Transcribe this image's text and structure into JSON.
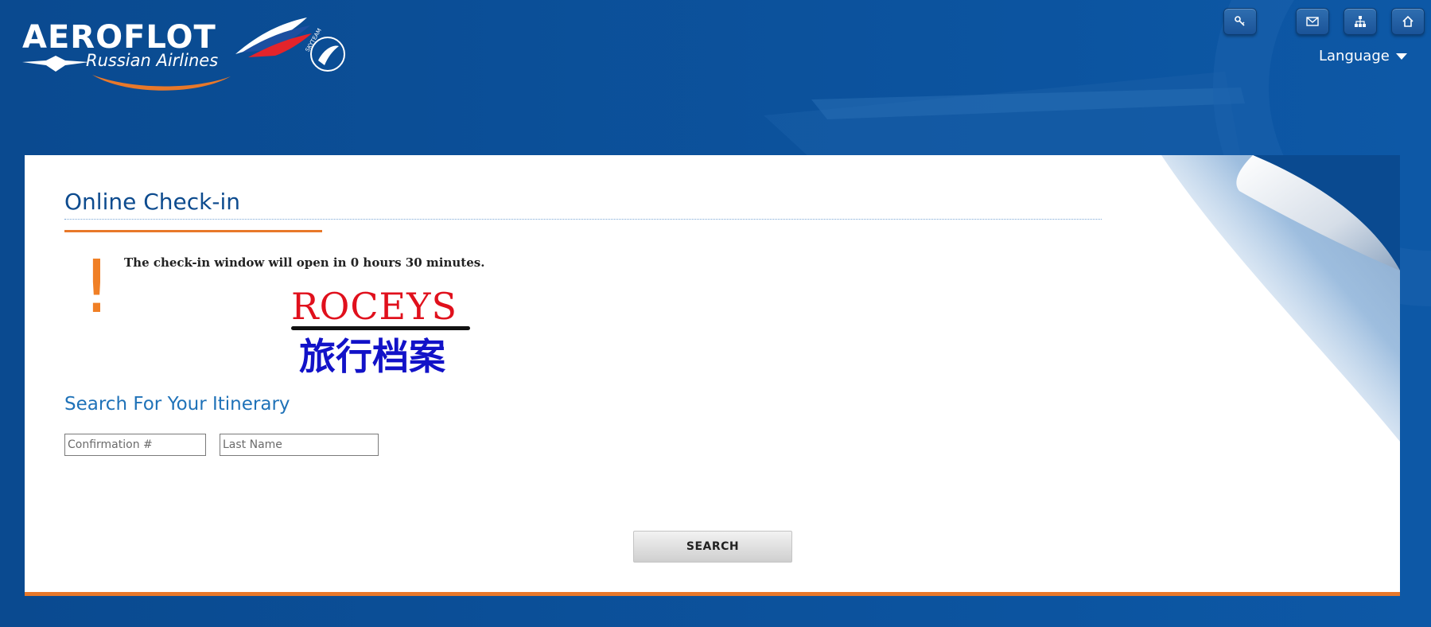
{
  "brand": {
    "name": "AEROFLOT",
    "subtitle": "Russian Airlines",
    "alliance": "SKYTEAM",
    "colors": {
      "primary_blue": "#0a4a90",
      "accent_orange": "#e8782a",
      "flag_red": "#e3242b",
      "flag_blue": "#1c4fa0"
    }
  },
  "header": {
    "icons": [
      {
        "name": "key-icon",
        "glyph": "⚿"
      },
      {
        "name": "mail-icon",
        "glyph": "✉"
      },
      {
        "name": "sitemap-icon",
        "glyph": "⊞"
      },
      {
        "name": "home-icon",
        "glyph": "⌂"
      }
    ],
    "language_label": "Language"
  },
  "main": {
    "title": "Online Check-in",
    "alert": {
      "icon": "!",
      "message": "The check-in window will open in 0 hours 30 minutes."
    },
    "watermark": {
      "latin": "ROCEYS",
      "cjk": "旅行档案"
    },
    "search": {
      "title": "Search For Your Itinerary",
      "confirmation_placeholder": "Confirmation #",
      "last_name_placeholder": "Last Name",
      "button_label": "SEARCH"
    }
  }
}
